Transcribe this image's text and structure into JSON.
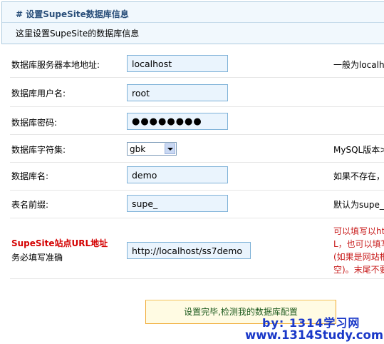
{
  "header": {
    "title_hash": "#",
    "title": "设置SupeSite数据库信息",
    "description": "这里设置SupeSite的数据库信息"
  },
  "fields": {
    "host": {
      "label": "数据库服务器本地地址:",
      "value": "localhost",
      "hint": "一般为localh"
    },
    "user": {
      "label": "数据库用户名:",
      "value": "root",
      "hint": ""
    },
    "password": {
      "label": "数据库密码:",
      "value": "●●●●●●●●",
      "hint": ""
    },
    "charset": {
      "label": "数据库字符集:",
      "value": "gbk",
      "hint": "MySQL版本>"
    },
    "dbname": {
      "label": "数据库名:",
      "value": "demo",
      "hint": "如果不存在，"
    },
    "prefix": {
      "label": "表名前缀:",
      "value": "supe_",
      "hint": "默认为supe_"
    },
    "url": {
      "label": "SupeSite站点URL地址",
      "sublabel": "务必填写准确",
      "value": "http://localhost/ss7demo",
      "hint_lines": [
        "可以填写以ht",
        "L，也可以填写",
        "(如果是网站根",
        "空)。末尾不要"
      ]
    }
  },
  "submit_label": "设置完毕,检测我的数据库配置",
  "watermark": {
    "line1": "by: 1314学习网",
    "line2": "www.1314Study.com"
  }
}
